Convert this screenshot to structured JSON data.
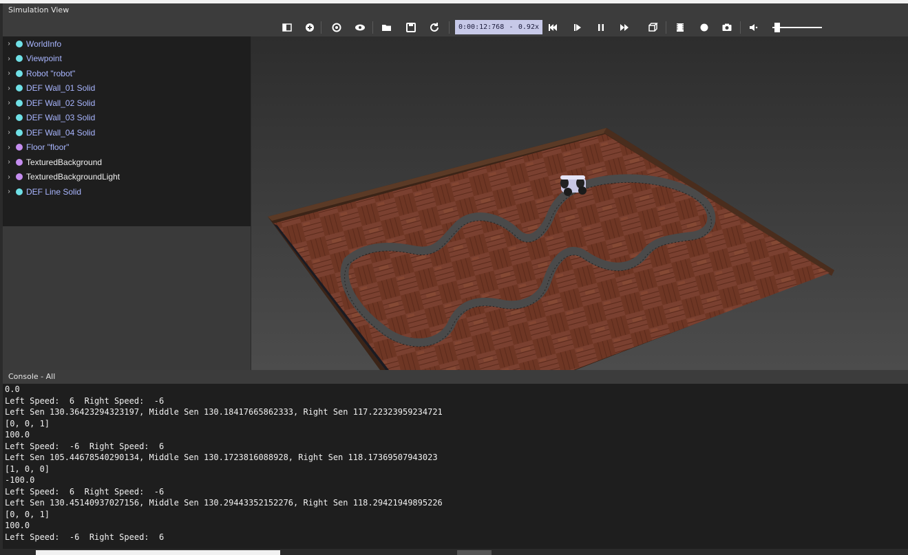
{
  "panel": {
    "title": "Simulation View"
  },
  "toolbar": {
    "buttons": [
      {
        "name": "toggle-panel-icon"
      },
      {
        "name": "add-node-icon"
      },
      {
        "name": "reset-view-icon"
      },
      {
        "name": "view-icon"
      },
      {
        "name": "open-world-icon"
      },
      {
        "name": "save-world-icon"
      },
      {
        "name": "reload-world-icon"
      },
      {
        "name": "reset-simulation-icon"
      },
      {
        "name": "step-icon"
      },
      {
        "name": "pause-icon"
      },
      {
        "name": "fast-forward-icon"
      },
      {
        "name": "3d-view-icon"
      },
      {
        "name": "record-movie-icon"
      },
      {
        "name": "record-icon"
      },
      {
        "name": "screenshot-icon"
      },
      {
        "name": "volume-icon"
      }
    ],
    "time": "0:00:12:768",
    "dash": "-",
    "speed": "0.92x",
    "volume_level": 0.05
  },
  "scene_tree": {
    "items": [
      {
        "label": "WorldInfo",
        "color": "cyan",
        "style": "blue"
      },
      {
        "label": "Viewpoint",
        "color": "cyan",
        "style": "blue"
      },
      {
        "label": "Robot \"robot\"",
        "color": "cyan",
        "style": "blue"
      },
      {
        "label": "DEF Wall_01 Solid",
        "color": "cyan",
        "style": "blue"
      },
      {
        "label": "DEF Wall_02 Solid",
        "color": "cyan",
        "style": "blue"
      },
      {
        "label": "DEF Wall_03 Solid",
        "color": "cyan",
        "style": "blue"
      },
      {
        "label": "DEF Wall_04 Solid",
        "color": "cyan",
        "style": "blue"
      },
      {
        "label": "Floor \"floor\"",
        "color": "purple",
        "style": "blue"
      },
      {
        "label": "TexturedBackground",
        "color": "purple",
        "style": "white"
      },
      {
        "label": "TexturedBackgroundLight",
        "color": "purple",
        "style": "white"
      },
      {
        "label": "DEF Line Solid",
        "color": "cyan",
        "style": "blue"
      }
    ]
  },
  "console": {
    "title": "Console - All",
    "lines": [
      "0.0",
      "Left Speed:  6  Right Speed:  -6",
      "Left Sen 130.36423294323197, Middle Sen 130.18417665862333, Right Sen 117.22323959234721",
      "[0, 0, 1]",
      "100.0",
      "Left Speed:  -6  Right Speed:  6",
      "Left Sen 105.44678540290134, Middle Sen 130.1723816088928, Right Sen 118.17369507943023",
      "[1, 0, 0]",
      "-100.0",
      "Left Speed:  6  Right Speed:  -6",
      "Left Sen 130.45140937027156, Middle Sen 130.29443352152276, Right Sen 118.29421949895226",
      "[0, 0, 1]",
      "100.0",
      "Left Speed:  -6  Right Speed:  6"
    ]
  },
  "colors": {
    "cyan_dot": "#6fe0e6",
    "purple_dot": "#c58df0",
    "node_label_blue": "#a9b6ff",
    "time_bg": "#c7c9e8"
  }
}
